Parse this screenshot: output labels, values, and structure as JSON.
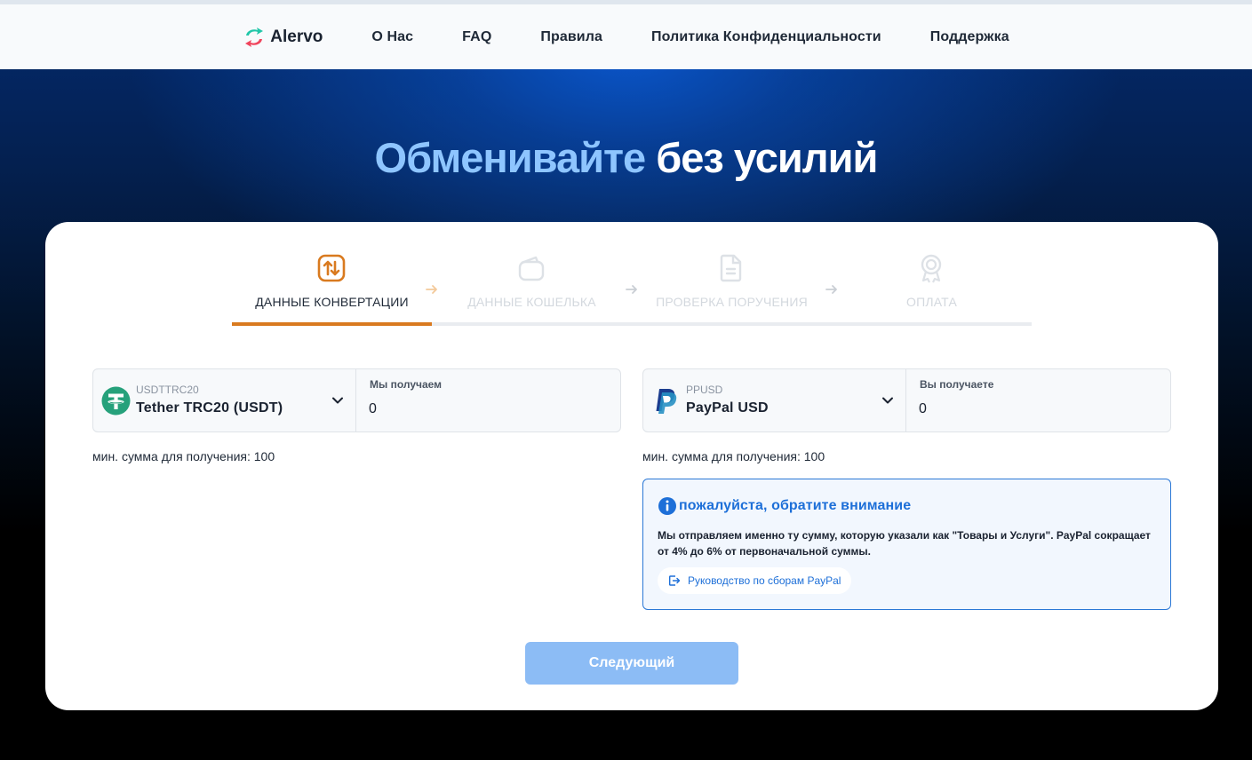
{
  "nav": {
    "brand": "Alervo",
    "links": [
      "О Нас",
      "FAQ",
      "Правила",
      "Политика Конфиденциальности",
      "Поддержка"
    ]
  },
  "hero": {
    "title_part1": "Обменивайте",
    "title_part2": "без усилий"
  },
  "steps": [
    {
      "label": "ДАННЫЕ КОНВЕРТАЦИИ",
      "icon": "exchange-arrows-icon",
      "active": true
    },
    {
      "label": "ДАННЫЕ КОШЕЛЬКА",
      "icon": "wallet-icon",
      "active": false
    },
    {
      "label": "ПРОВЕРКА ПОРУЧЕНИЯ",
      "icon": "document-icon",
      "active": false
    },
    {
      "label": "ОПЛАТА",
      "icon": "award-icon",
      "active": false
    }
  ],
  "send": {
    "code": "USDTTRC20",
    "name": "Tether TRC20 (USDT)",
    "amount_label": "Мы получаем",
    "amount_value": "0",
    "min_text": "мин. сумма для получения: 100"
  },
  "receive": {
    "code": "PPUSD",
    "name": "PayPal USD",
    "amount_label": "Вы получаете",
    "amount_value": "0",
    "min_text": "мин. сумма для получения: 100"
  },
  "notice": {
    "title": "пожалуйста, обратите внимание",
    "body": "Мы отправляем именно ту сумму, которую указали как \"Товары и Услуги\". PayPal сокращает от 4% до 6% от первоначальной суммы.",
    "guide_link": "Руководство по сборам PayPal"
  },
  "next_button": "Следующий",
  "colors": {
    "accent_orange": "#d97a1f",
    "primary_blue": "#1d6fd8",
    "button_disabled": "#8cbcf5",
    "hero_highlight": "#8ec5ff"
  }
}
